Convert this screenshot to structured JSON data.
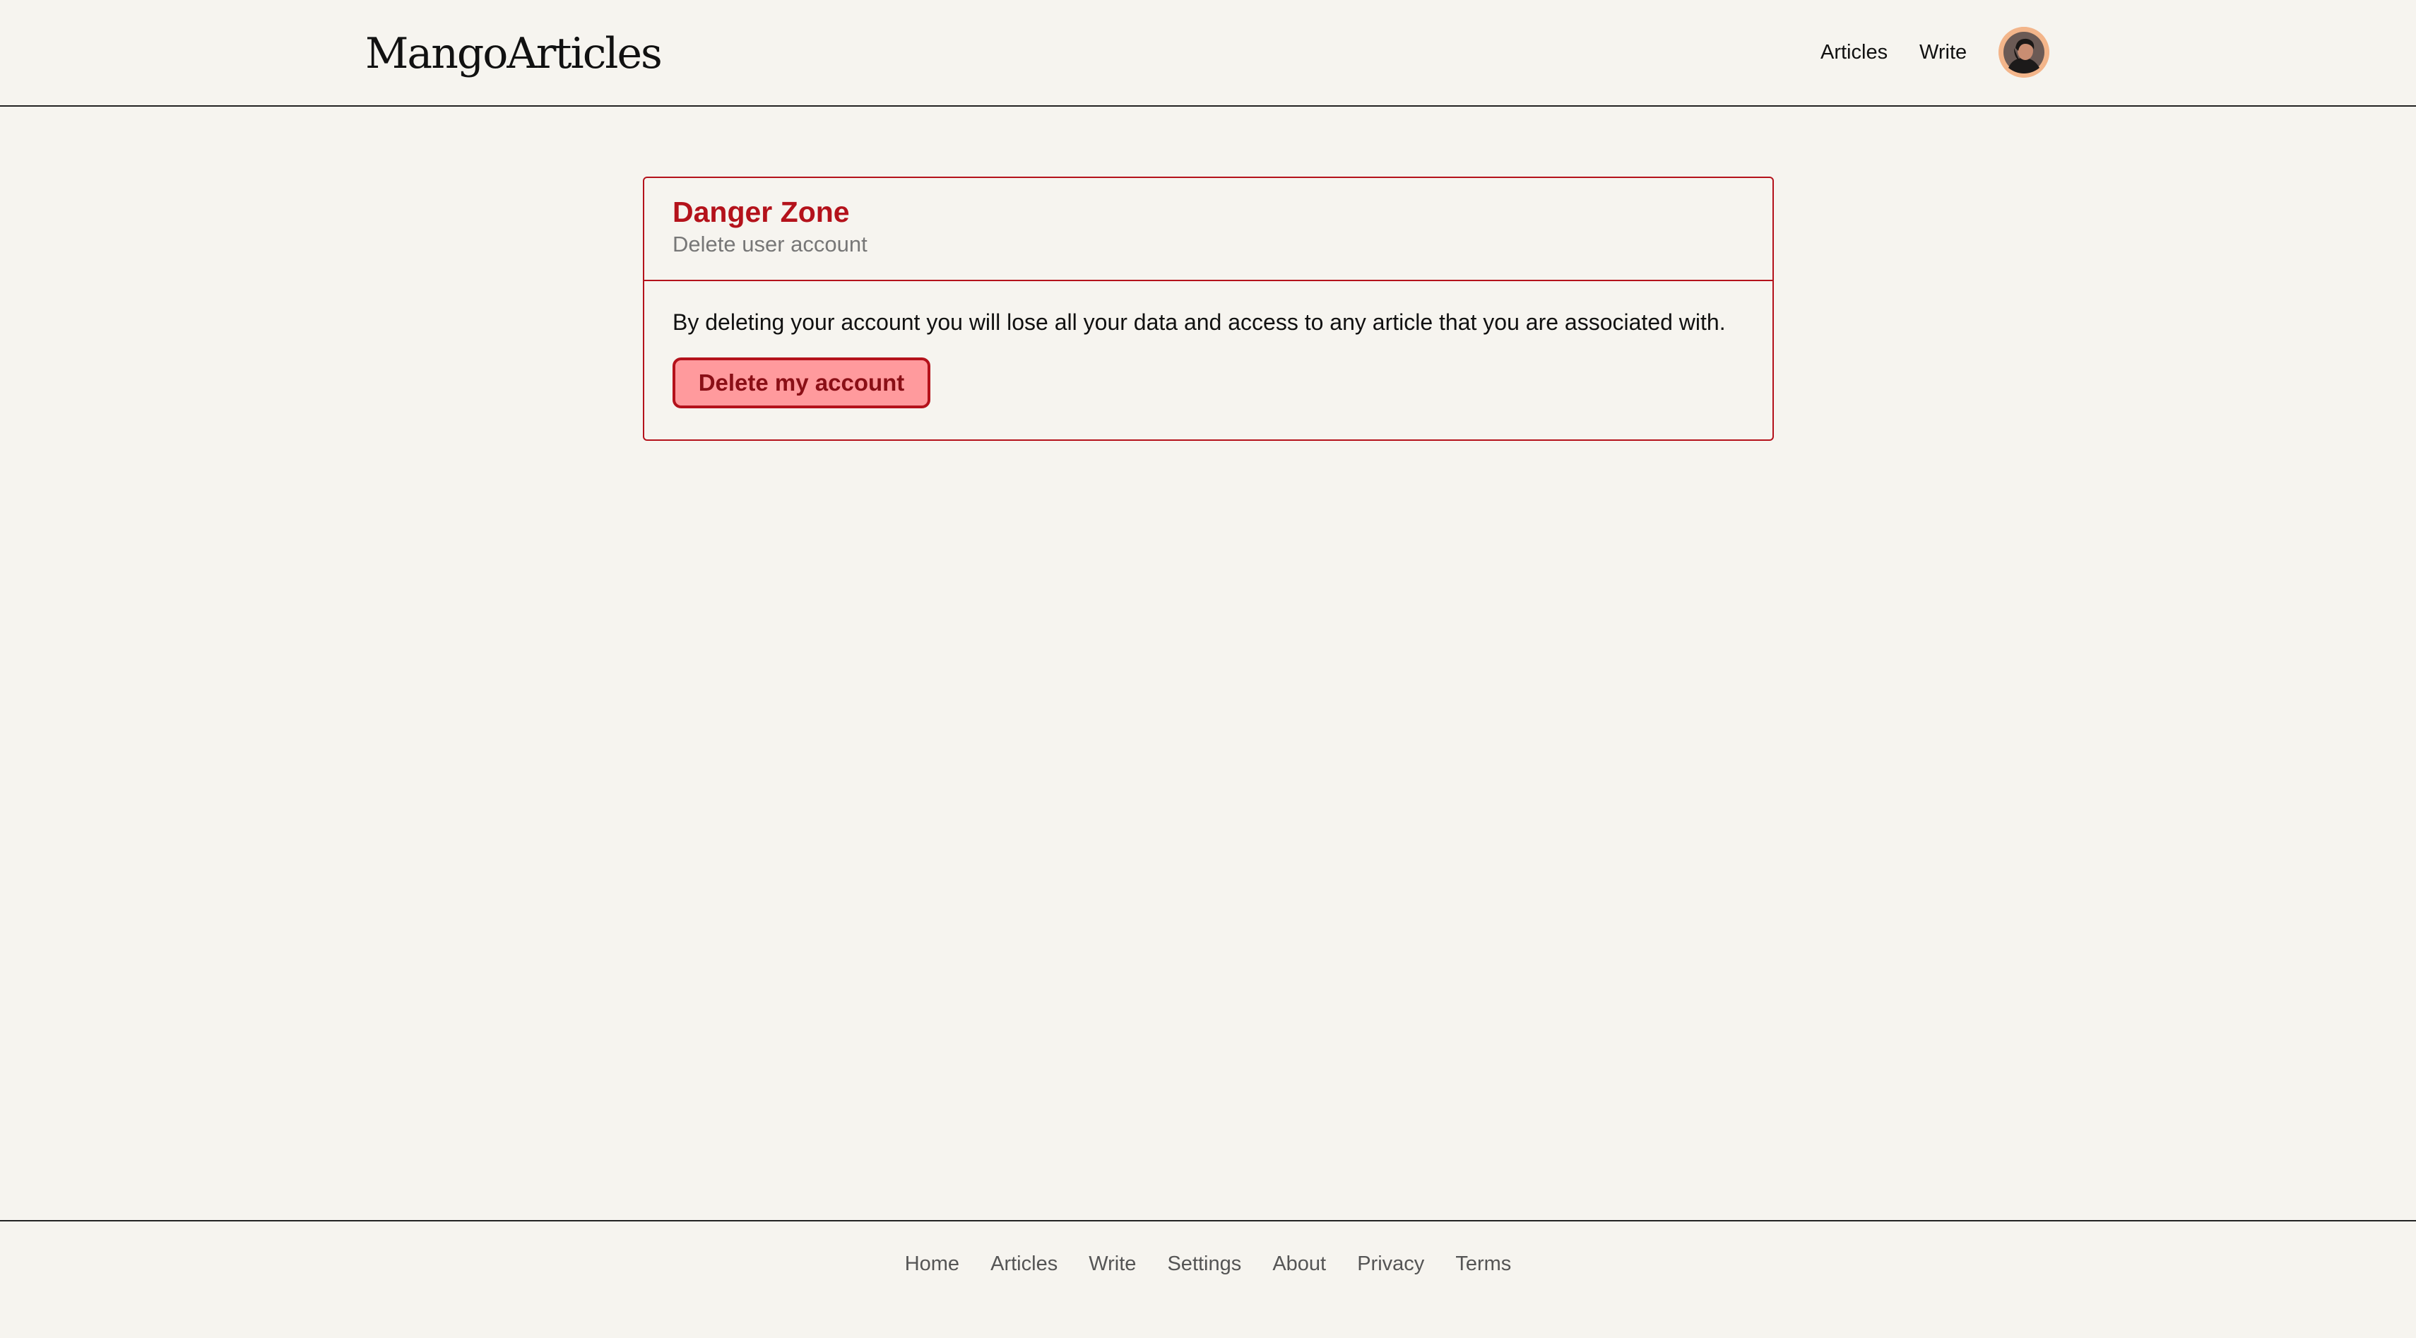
{
  "header": {
    "logo": "MangoArticles",
    "nav": [
      {
        "label": "Articles"
      },
      {
        "label": "Write"
      }
    ],
    "avatar_icon": "user-avatar"
  },
  "danger_zone": {
    "title": "Danger Zone",
    "subtitle": "Delete user account",
    "description": "By deleting your account you will lose all your data and access to any article that you are associated with.",
    "button_label": "Delete my account",
    "accent_color": "#b4121b",
    "button_fill": "#ff9a9d"
  },
  "footer": {
    "links": [
      {
        "label": "Home"
      },
      {
        "label": "Articles"
      },
      {
        "label": "Write"
      },
      {
        "label": "Settings"
      },
      {
        "label": "About"
      },
      {
        "label": "Privacy"
      },
      {
        "label": "Terms"
      }
    ]
  },
  "colors": {
    "background": "#f6f4ef",
    "text": "#111111"
  }
}
